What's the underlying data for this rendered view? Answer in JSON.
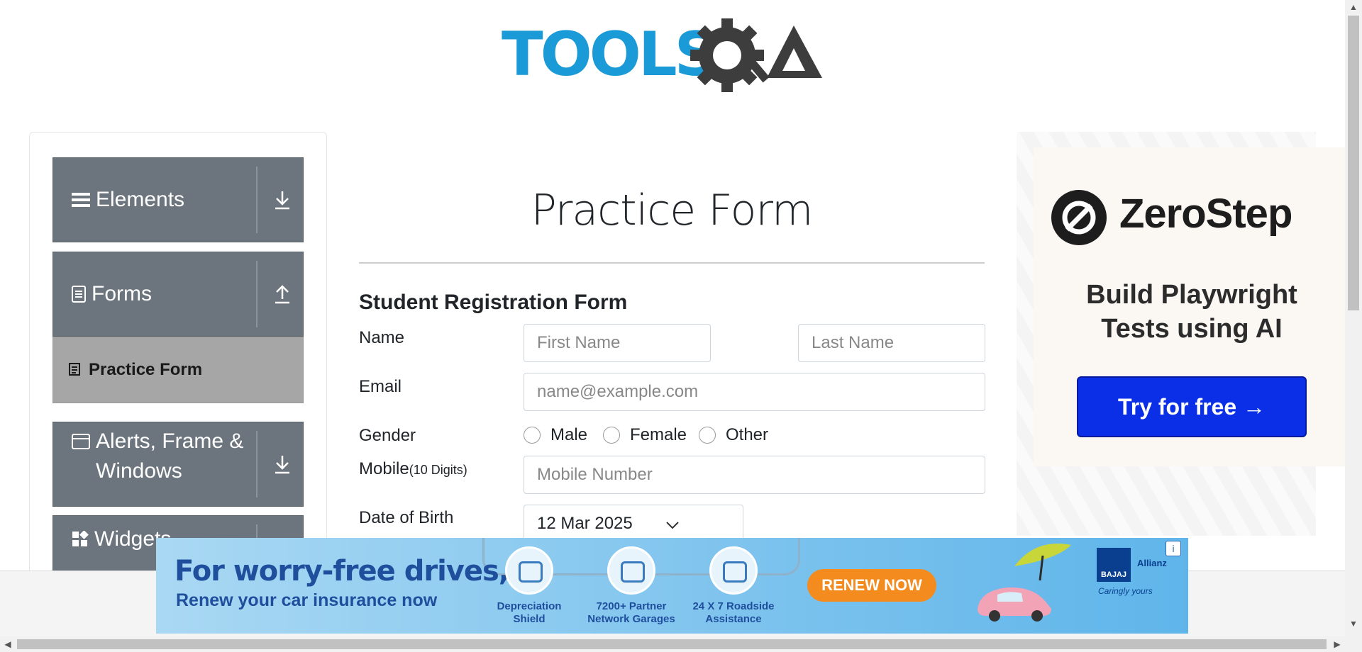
{
  "brand": {
    "logo_text": "TOOLSQA"
  },
  "sidebar": {
    "groups": [
      {
        "label": "Elements",
        "icon": "hamburger-icon",
        "arrow": "download-arrow-icon"
      },
      {
        "label": "Forms",
        "icon": "document-icon",
        "arrow": "upload-arrow-icon"
      },
      {
        "label": "Alerts, Frame & Windows",
        "label_line1": "Alerts, Frame &",
        "label_line2": "Windows",
        "icon": "window-icon",
        "arrow": "download-arrow-icon"
      },
      {
        "label": "Widgets",
        "icon": "widgets-icon"
      }
    ],
    "active_item": "Practice Form"
  },
  "main": {
    "title": "Practice Form",
    "subtitle": "Student Registration Form",
    "fields": {
      "name_label": "Name",
      "first_name_placeholder": "First Name",
      "last_name_placeholder": "Last Name",
      "email_label": "Email",
      "email_placeholder": "name@example.com",
      "gender_label": "Gender",
      "gender_options": [
        "Male",
        "Female",
        "Other"
      ],
      "mobile_label": "Mobile",
      "mobile_hint": "(10 Digits)",
      "mobile_placeholder": "Mobile Number",
      "dob_label": "Date of Birth",
      "dob_value": "12 Mar 2025"
    }
  },
  "ad_right": {
    "brand": "ZeroStep",
    "tagline_line1": "Build Playwright",
    "tagline_line2": "Tests using AI",
    "cta": "Try for free →"
  },
  "ad_bottom": {
    "headline": "For worry-free drives,",
    "subheadline": "Renew your car insurance now",
    "features": [
      {
        "line1": "Depreciation",
        "line2": "Shield"
      },
      {
        "line1": "7200+ Partner",
        "line2": "Network Garages"
      },
      {
        "line1": "24 X 7 Roadside",
        "line2": "Assistance"
      }
    ],
    "cta": "RENEW NOW",
    "brand1": "BAJAJ",
    "brand2": "Allianz",
    "slogan": "Caringly yours",
    "info": "i"
  },
  "colors": {
    "sidebar_group": "#6c757d",
    "sidebar_active": "#a6a6a6",
    "logo_blue": "#1a9ad6",
    "logo_dark": "#3d3d3d",
    "cta_blue": "#0a2fe6",
    "renew_orange": "#f38b1f"
  }
}
